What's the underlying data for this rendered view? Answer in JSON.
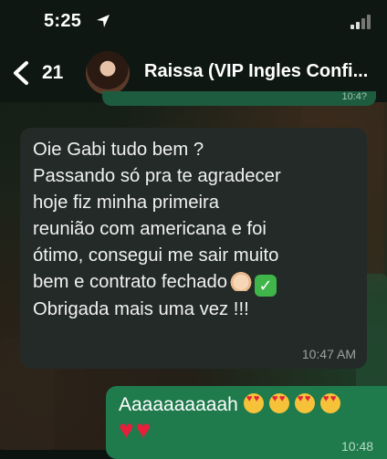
{
  "status_bar": {
    "time": "5:25",
    "location_icon": "location-arrow-icon",
    "signal_icon": "cellular-signal-icon"
  },
  "header": {
    "back_count": "21",
    "back_icon": "chevron-left-icon",
    "contact_name": "Raissa (VIP Ingles Confi..."
  },
  "previous_message": {
    "time": "10:4?"
  },
  "received_message": {
    "lines": [
      "Oie Gabi tudo bem ?",
      "Passando só pra te agradecer",
      "hoje fiz minha primeira",
      "reunião com americana e foi",
      "ótimo, consegui me sair muito",
      "bem e contrato fechado",
      "Obrigada mais uma vez !!!"
    ],
    "emojis": [
      "flexed-biceps-icon",
      "check-mark-button-icon"
    ],
    "time": "10:47 AM"
  },
  "sent_message": {
    "text": "Aaaaaaaaaah",
    "emojis": [
      "heart-eyes-icon",
      "heart-eyes-icon",
      "heart-eyes-icon",
      "heart-eyes-icon",
      "red-heart-icon",
      "red-heart-icon"
    ],
    "time": "10:48"
  },
  "colors": {
    "header_bg": "#0f1712",
    "received_bubble": "#232a27",
    "sent_bubble": "#1f7a4c",
    "heart": "#e81f3a"
  }
}
